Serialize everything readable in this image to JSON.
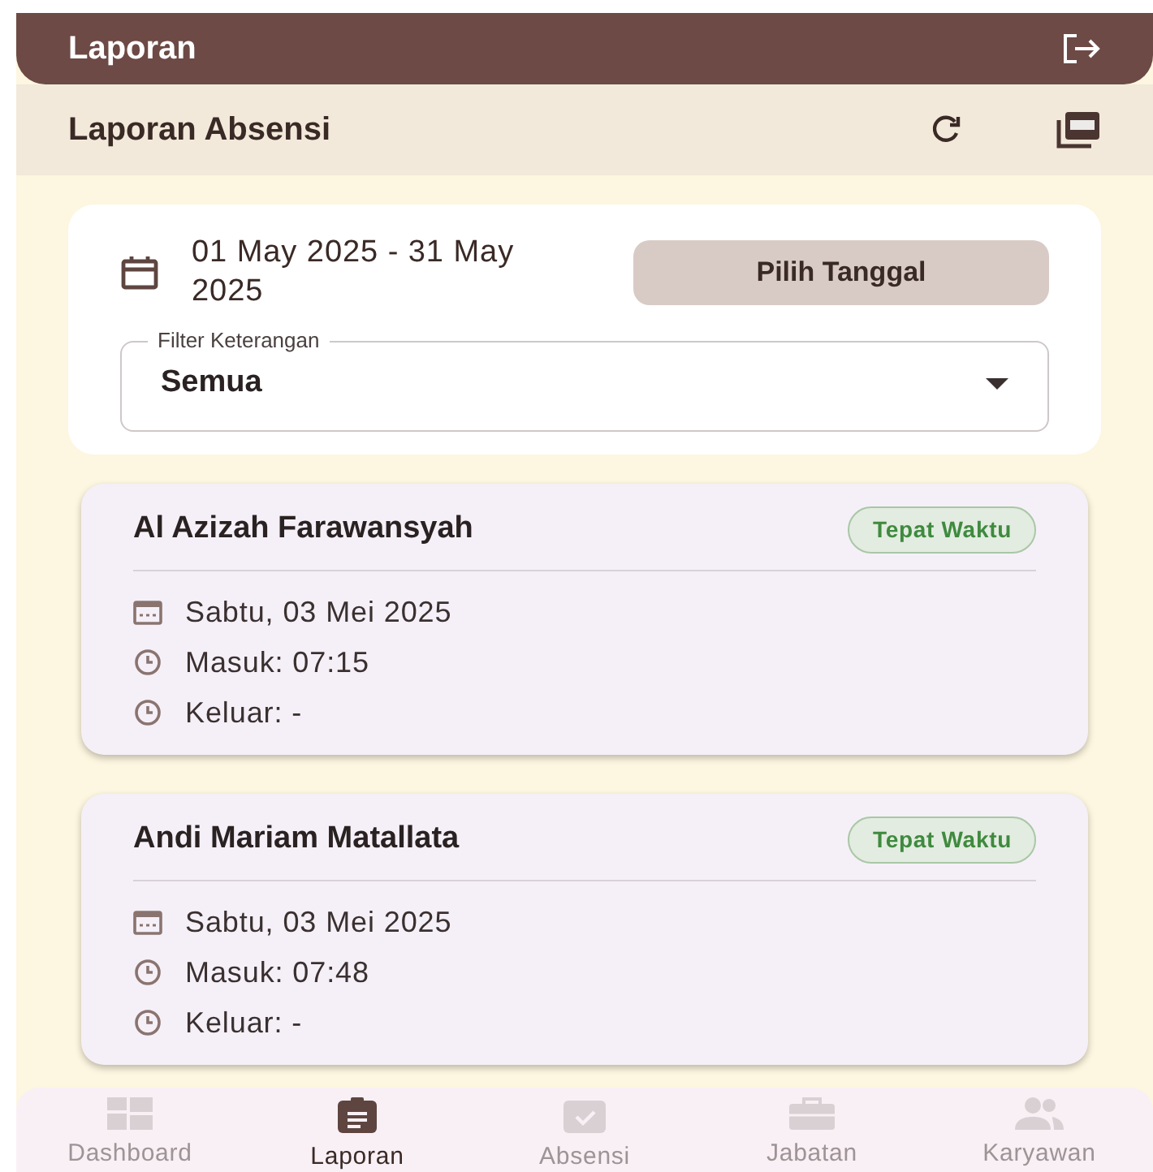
{
  "app_bar": {
    "title": "Laporan"
  },
  "header": {
    "title": "Laporan Absensi"
  },
  "date_filter": {
    "range": "01 May 2025 - 31 May 2025",
    "button": "Pilih Tanggal"
  },
  "filter": {
    "label": "Filter Keterangan",
    "value": "Semua"
  },
  "records": [
    {
      "name": "Al Azizah Farawansyah",
      "status": "Tepat Waktu",
      "date": "Sabtu, 03 Mei 2025",
      "check_in": "Masuk: 07:15",
      "check_out": "Keluar: -"
    },
    {
      "name": "Andi Mariam Matallata",
      "status": "Tepat Waktu",
      "date": "Sabtu, 03 Mei 2025",
      "check_in": "Masuk: 07:48",
      "check_out": "Keluar: -"
    }
  ],
  "bottom_nav": [
    {
      "kind": "dashboard",
      "label": "Dashboard",
      "selected": false
    },
    {
      "kind": "report",
      "label": "Laporan",
      "selected": true
    },
    {
      "kind": "attendance",
      "label": "Absensi",
      "selected": false
    },
    {
      "kind": "job",
      "label": "Jabatan",
      "selected": false
    },
    {
      "kind": "people",
      "label": "Karyawan",
      "selected": false
    }
  ]
}
